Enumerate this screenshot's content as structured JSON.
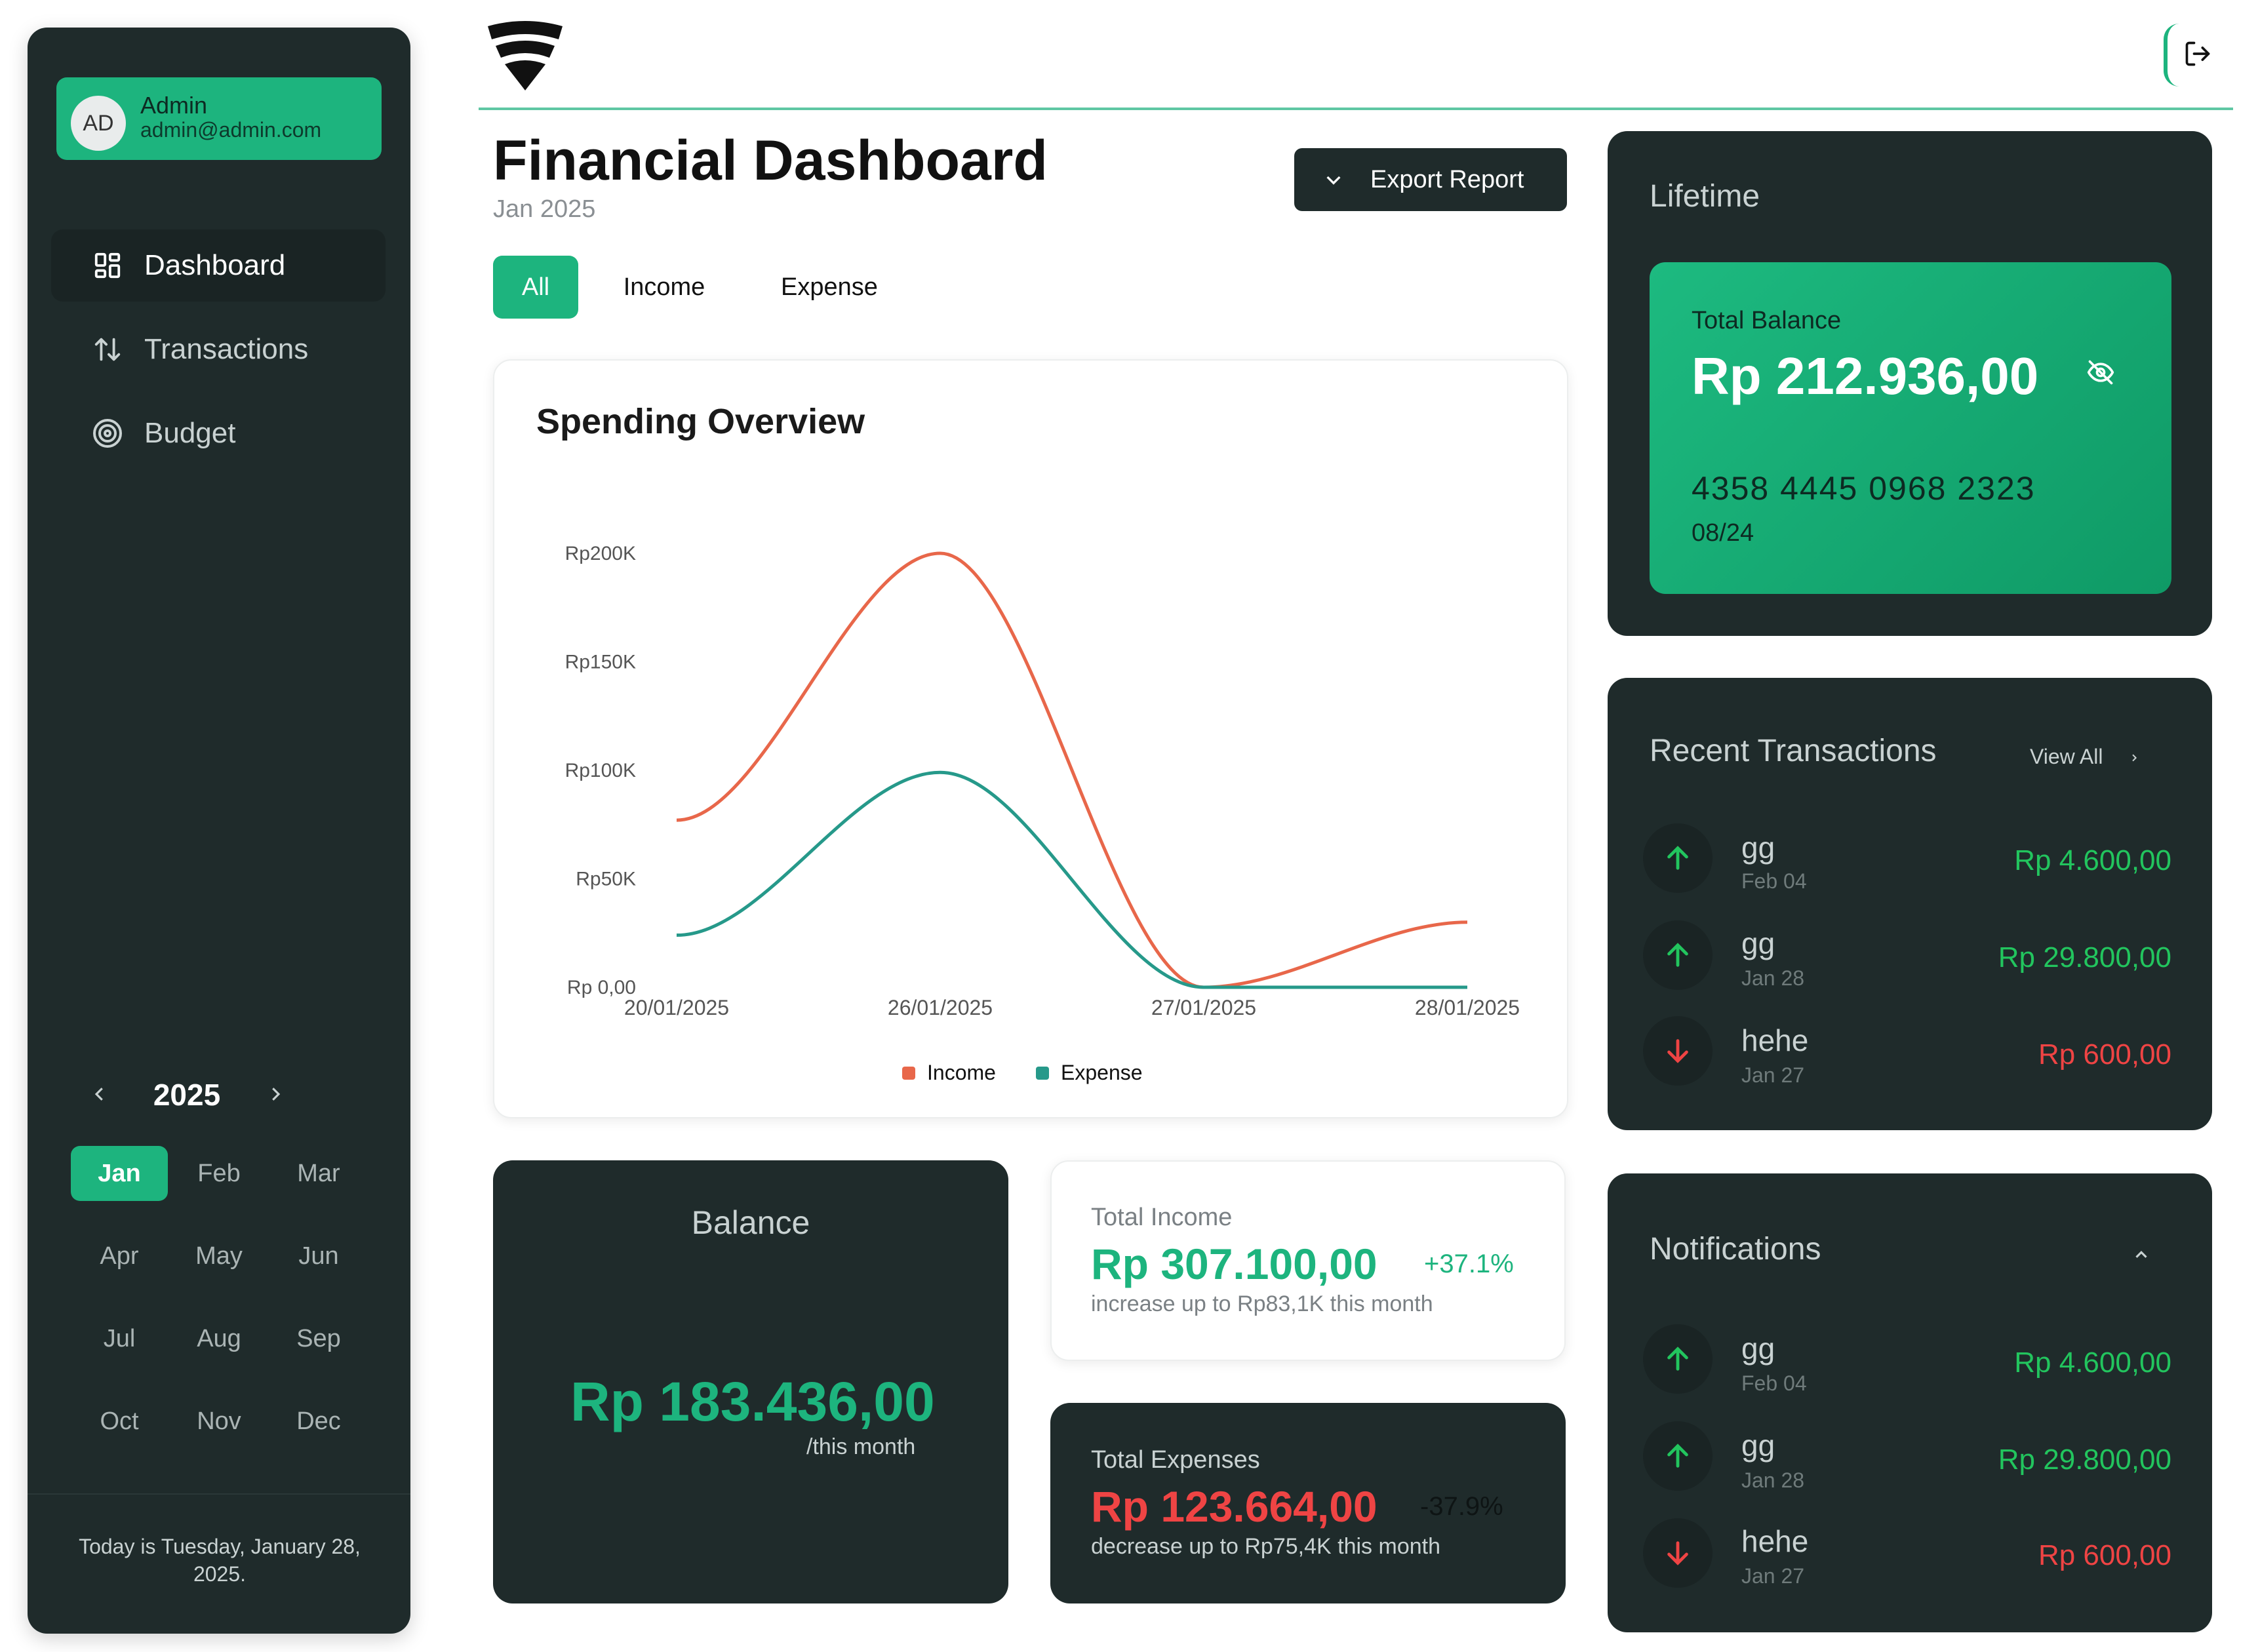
{
  "user": {
    "initials": "AD",
    "name": "Admin",
    "email": "admin@admin.com"
  },
  "nav": [
    {
      "label": "Dashboard",
      "icon": "grid-icon",
      "active": true
    },
    {
      "label": "Transactions",
      "icon": "swap-arrows-icon",
      "active": false
    },
    {
      "label": "Budget",
      "icon": "target-icon",
      "active": false
    }
  ],
  "calendar": {
    "year": "2025",
    "months": [
      "Jan",
      "Feb",
      "Mar",
      "Apr",
      "May",
      "Jun",
      "Jul",
      "Aug",
      "Sep",
      "Oct",
      "Nov",
      "Dec"
    ],
    "selected": "Jan"
  },
  "today_text": "Today is Tuesday, January 28, 2025.",
  "header": {
    "title": "Financial Dashboard",
    "subtitle": "Jan 2025",
    "export_label": "Export Report"
  },
  "tabs": [
    "All",
    "Income",
    "Expense"
  ],
  "active_tab": "All",
  "spending": {
    "title": "Spending Overview",
    "legend": [
      "Income",
      "Expense"
    ]
  },
  "chart_data": {
    "type": "line",
    "title": "Spending Overview",
    "x": [
      "20/01/2025",
      "26/01/2025",
      "27/01/2025",
      "28/01/2025"
    ],
    "y_ticks": [
      "Rp 0,00",
      "Rp50K",
      "Rp100K",
      "Rp150K",
      "Rp200K"
    ],
    "ylim": [
      0,
      200000
    ],
    "series": [
      {
        "name": "Income",
        "color": "#e8674a",
        "values": [
          77000,
          200000,
          0,
          30000
        ]
      },
      {
        "name": "Expense",
        "color": "#26998a",
        "values": [
          24000,
          99000,
          0,
          0
        ]
      }
    ],
    "legend_position": "bottom"
  },
  "balance": {
    "label": "Balance",
    "value": "Rp 183.436,00",
    "sub": "/this month"
  },
  "income": {
    "label": "Total Income",
    "value": "Rp 307.100,00",
    "change": "+37.1%",
    "sub": "increase up to Rp83,1K this month"
  },
  "expenses": {
    "label": "Total Expenses",
    "value": "Rp 123.664,00",
    "change": "-37.9%",
    "sub": "decrease up to Rp75,4K this month"
  },
  "lifetime": {
    "label": "Lifetime",
    "balance_label": "Total Balance",
    "balance_value": "Rp 212.936,00",
    "card_number": "4358 4445 0968 2323",
    "card_expiry": "08/24"
  },
  "recent": {
    "title": "Recent Transactions",
    "view_all": "View All",
    "items": [
      {
        "name": "gg",
        "date": "Feb 04",
        "amount": "Rp 4.600,00",
        "type": "in"
      },
      {
        "name": "gg",
        "date": "Jan 28",
        "amount": "Rp 29.800,00",
        "type": "in"
      },
      {
        "name": "hehe",
        "date": "Jan 27",
        "amount": "Rp 600,00",
        "type": "out"
      }
    ]
  },
  "notifications": {
    "title": "Notifications",
    "items": [
      {
        "name": "gg",
        "date": "Feb 04",
        "amount": "Rp 4.600,00",
        "type": "in"
      },
      {
        "name": "gg",
        "date": "Jan 28",
        "amount": "Rp 29.800,00",
        "type": "in"
      },
      {
        "name": "hehe",
        "date": "Jan 27",
        "amount": "Rp 600,00",
        "type": "out"
      }
    ]
  },
  "colors": {
    "accent": "#1db47e",
    "dark_panel": "#1f2b2b",
    "income_line": "#e8674a",
    "expense_line": "#26998a",
    "positive": "#22c55e",
    "negative": "#ef4444"
  }
}
